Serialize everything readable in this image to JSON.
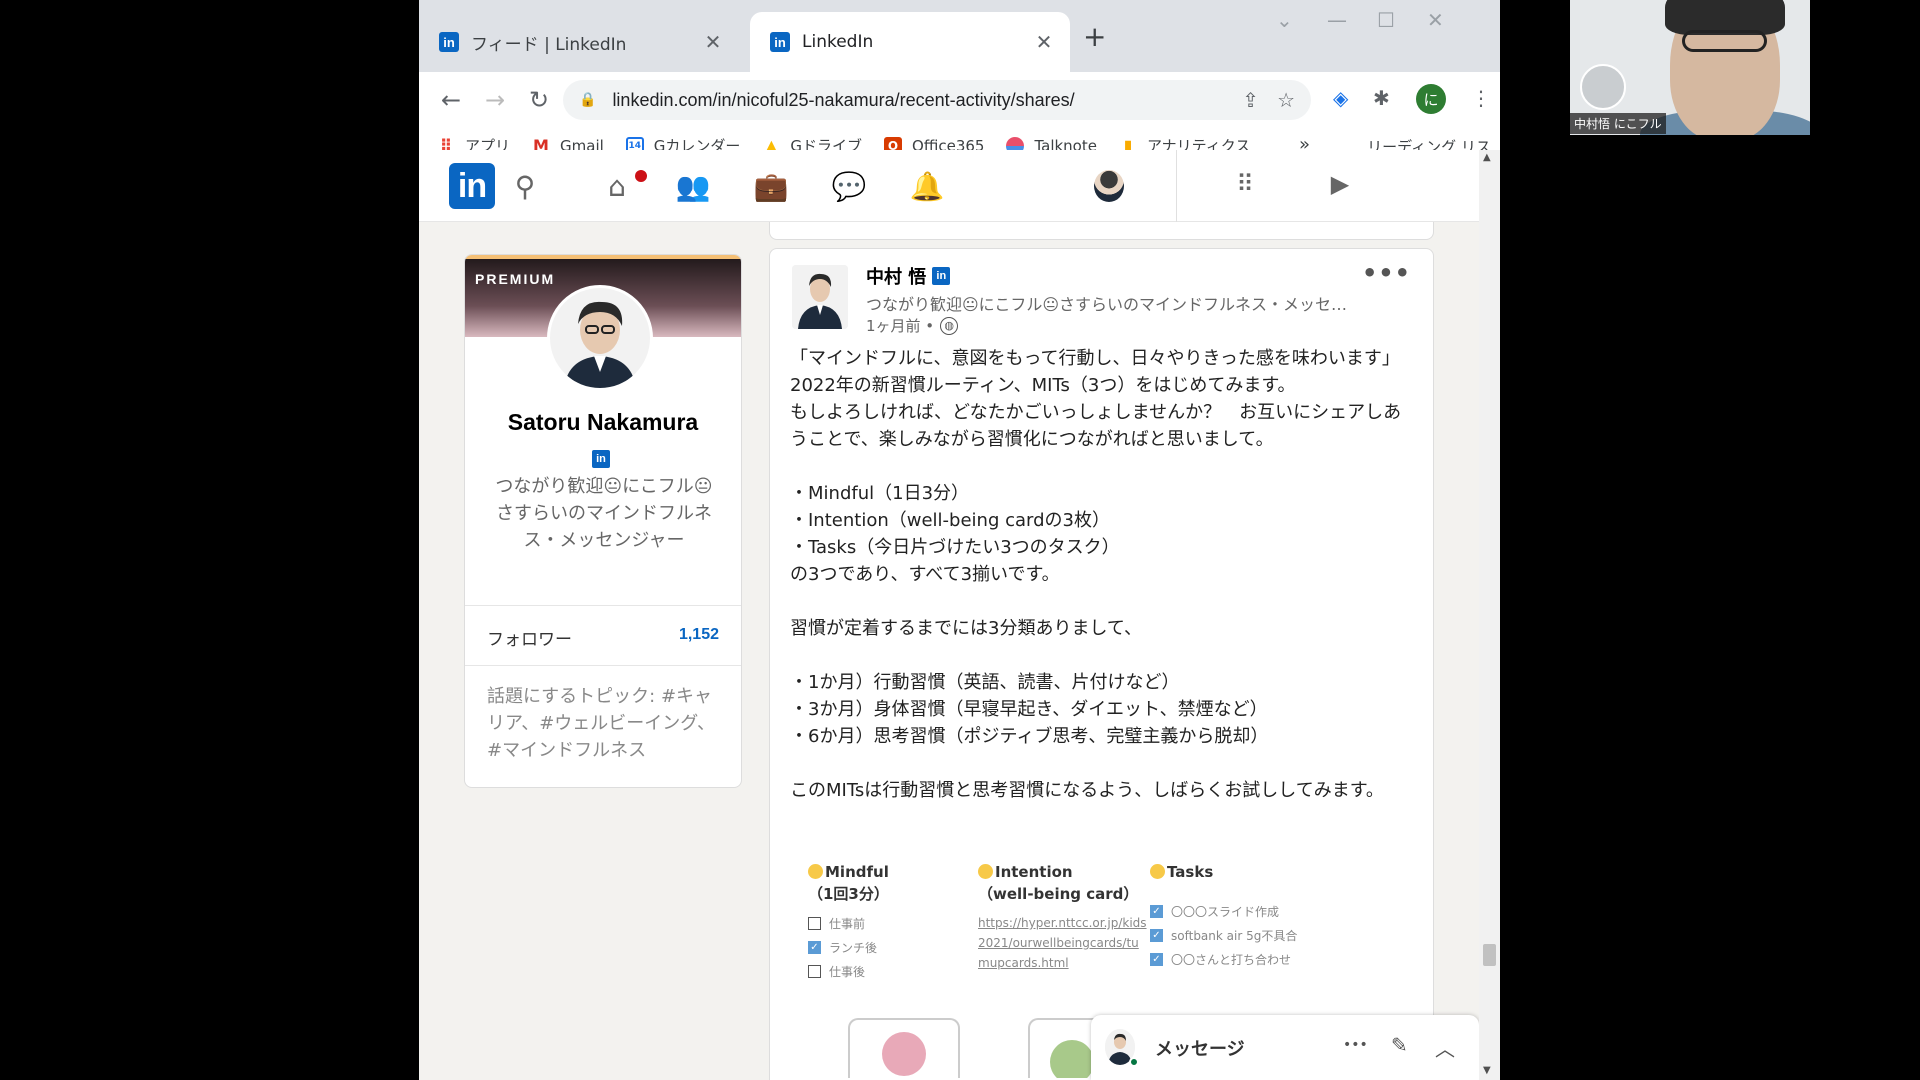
{
  "browser": {
    "tabs": [
      {
        "title": "フィード | LinkedIn",
        "active": false
      },
      {
        "title": "LinkedIn",
        "active": true
      }
    ],
    "url": "linkedin.com/in/nicoful25-nakamura/recent-activity/shares/",
    "profile_initial": "に",
    "bookmarks": [
      {
        "label": "アプリ",
        "icon": "apps-grid-icon"
      },
      {
        "label": "Gmail",
        "icon": "gmail-icon"
      },
      {
        "label": "Gカレンダー",
        "icon": "calendar-icon"
      },
      {
        "label": "Gドライブ",
        "icon": "drive-icon"
      },
      {
        "label": "Office365",
        "icon": "office-icon"
      },
      {
        "label": "Talknote",
        "icon": "talknote-icon"
      },
      {
        "label": "アナリティクス",
        "icon": "analytics-icon"
      }
    ],
    "bookmarks_overflow": "»",
    "reading_list": "リーディング リスト",
    "calendar_icon_text": "14"
  },
  "linkedin": {
    "logo": "in",
    "accent": "#0a66c2",
    "profile": {
      "premium_label": "PREMIUM",
      "name": "Satoru Nakamura",
      "headline": "つながり歓迎😐にこフル😐さすらいのマインドフルネス・メッセンジャー",
      "followers_label": "フォロワー",
      "followers_count": "1,152",
      "topics": "話題にするトピック: #キャリア、#ウェルビーイング、#マインドフルネス"
    },
    "post": {
      "author": "中村 悟",
      "author_headline": "つながり歓迎😐にこフル😐さすらいのマインドフルネス・メッセ…",
      "time": "1ヶ月前 •",
      "more": "•••",
      "body": "「マインドフルに、意図をもって行動し、日々やりきった感を味わいます」\n2022年の新習慣ルーティン、MITs（3つ）をはじめてみます。\nもしよろしければ、どなたかごいっしょしませんか？　お互いにシェアしあうことで、楽しみながら習慣化につながればと思いまして。\n\n・Mindful（1日3分）\n・Intention（well-being cardの3枚）\n・Tasks（今日片づけたい3つのタスク）\nの3つであり、すべて3揃いです。\n\n習慣が定着するまでには3分類ありまして、\n\n・1か月）行動習慣（英語、読書、片付けなど）\n・3か月）身体習慣（早寝早起き、ダイエット、禁煙など）\n・6か月）思考習慣（ポジティブ思考、完璧主義から脱却）\n\nこのMITsは行動習慣と思考習慣になるよう、しばらくお試ししてみます。",
      "image": {
        "mindful": {
          "title": "Mindful",
          "sub": "（1回3分）",
          "items": [
            {
              "label": "仕事前",
              "checked": false
            },
            {
              "label": "ランチ後",
              "checked": true
            },
            {
              "label": "仕事後",
              "checked": false
            }
          ]
        },
        "intention": {
          "title": "Intention",
          "sub": "（well-being card）",
          "url": "https://hyper.nttcc.or.jp/kids2021/ourwellbeingcards/tumupcards.html"
        },
        "tasks": {
          "title": "Tasks",
          "items": [
            {
              "label": "〇〇〇スライド作成",
              "checked": true
            },
            {
              "label": "softbank air 5g不具合",
              "checked": true
            },
            {
              "label": "〇〇さんと打ち合わせ",
              "checked": true
            }
          ]
        }
      }
    },
    "messaging": {
      "label": "メッセージ",
      "more": "•••"
    }
  },
  "video_call": {
    "participant": "中村悟 にこフル"
  }
}
